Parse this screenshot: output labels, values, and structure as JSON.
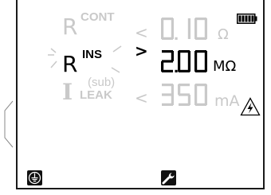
{
  "measurements": [
    {
      "id": "rcont",
      "symbol": "R",
      "superscript": "CONT",
      "state": "inactive",
      "arrow": "<",
      "value": "0.10",
      "unit": "Ω"
    },
    {
      "id": "rins",
      "symbol": "R",
      "superscript": "INS",
      "state": "selected",
      "arrow": ">",
      "value": "2.00",
      "unit": "MΩ"
    },
    {
      "id": "ileak",
      "symbol": "I",
      "superscript": "(sub)",
      "subscript": "LEAK",
      "state": "inactive",
      "arrow": "<",
      "value": "350",
      "unit": "mA"
    }
  ],
  "indicators": {
    "battery_icon": "battery-full-icon",
    "warning_icon": "high-voltage-warning-icon"
  },
  "softkeys": [
    {
      "icon": "earth-ground-icon"
    },
    {
      "icon": "wrench-icon"
    }
  ],
  "colors": {
    "active": "#000000",
    "inactive": "#c9c9c9",
    "frame": "#1a1a1a"
  }
}
